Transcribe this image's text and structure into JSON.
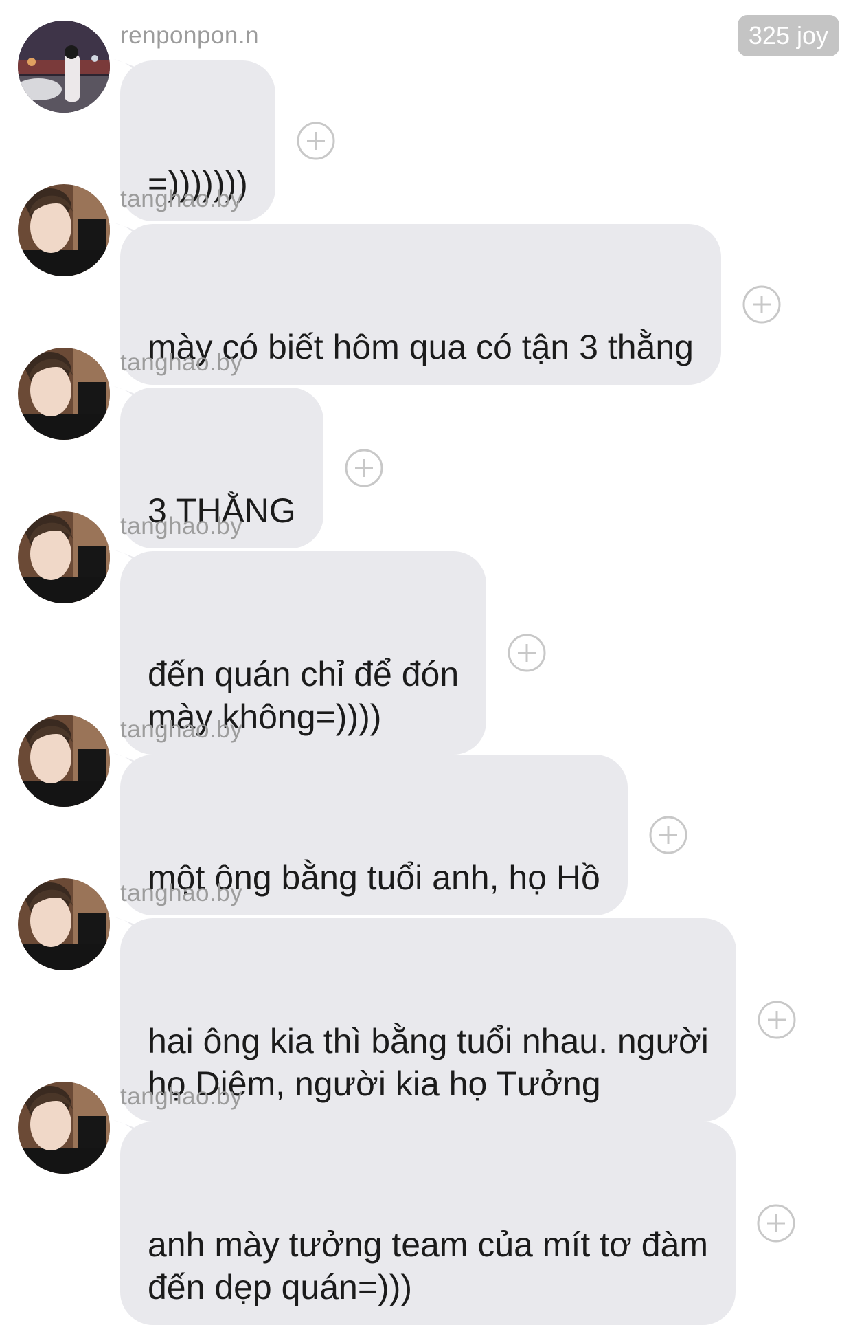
{
  "header": {
    "badge": "325 joy"
  },
  "messages": [
    {
      "username": "renponpon.n",
      "avatar": "avatar-renponpon",
      "text": "=)))))))"
    },
    {
      "username": "tanghao.by",
      "avatar": "avatar-tanghao",
      "text": "mày có biết hôm qua có tận 3 thằng"
    },
    {
      "username": "tanghao.by",
      "avatar": "avatar-tanghao",
      "text": "3 THẰNG"
    },
    {
      "username": "tanghao.by",
      "avatar": "avatar-tanghao",
      "text": "đến quán chỉ để đón\nmày không=))))"
    },
    {
      "username": "tanghao.by",
      "avatar": "avatar-tanghao",
      "text": "một ông bằng tuổi anh, họ Hồ"
    },
    {
      "username": "tanghao.by",
      "avatar": "avatar-tanghao",
      "text": "hai ông kia thì bằng tuổi nhau. người\nhọ Diêm, người kia họ Tưởng"
    },
    {
      "username": "tanghao.by",
      "avatar": "avatar-tanghao",
      "text": "anh mày tưởng team của mít tơ đàm\nđến dẹp quán=)))"
    }
  ],
  "icons": {
    "react": "add-reaction-icon"
  },
  "colors": {
    "bubble": "#e9e9ed",
    "username": "#9c9c9c",
    "badge": "#c4c4c4",
    "text": "#1b1b1b"
  }
}
